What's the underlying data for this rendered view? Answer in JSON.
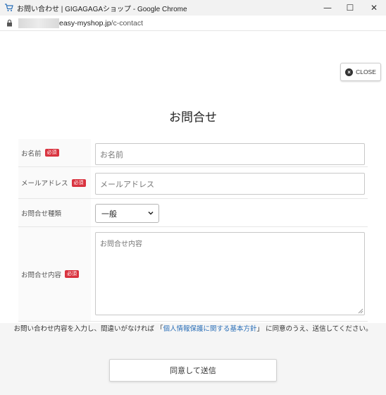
{
  "window": {
    "title": "お問い合わせ | GIGAGAGAショップ - Google Chrome",
    "favicon": "cart-icon",
    "controls": {
      "minimize": "—",
      "maximize": "☐",
      "close": "✕"
    }
  },
  "address_bar": {
    "host": "easy-myshop.jp",
    "path": "/c-contact"
  },
  "close_button": {
    "label": "CLOSE"
  },
  "form": {
    "title": "お問合せ",
    "required_badge": "必須",
    "fields": {
      "name": {
        "label": "お名前",
        "placeholder": "お名前"
      },
      "email": {
        "label": "メールアドレス",
        "placeholder": "メールアドレス"
      },
      "type": {
        "label": "お問合せ種類",
        "selected": "一般"
      },
      "content": {
        "label": "お問合せ内容",
        "placeholder": "お問合せ内容"
      }
    }
  },
  "notice": {
    "before": "お問い合わせ内容を入力し、間違いがなければ 「",
    "link": "個人情報保護に関する基本方針",
    "after": "」 に同意のうえ、送信してください。"
  },
  "submit": {
    "label": "同意して送信"
  }
}
